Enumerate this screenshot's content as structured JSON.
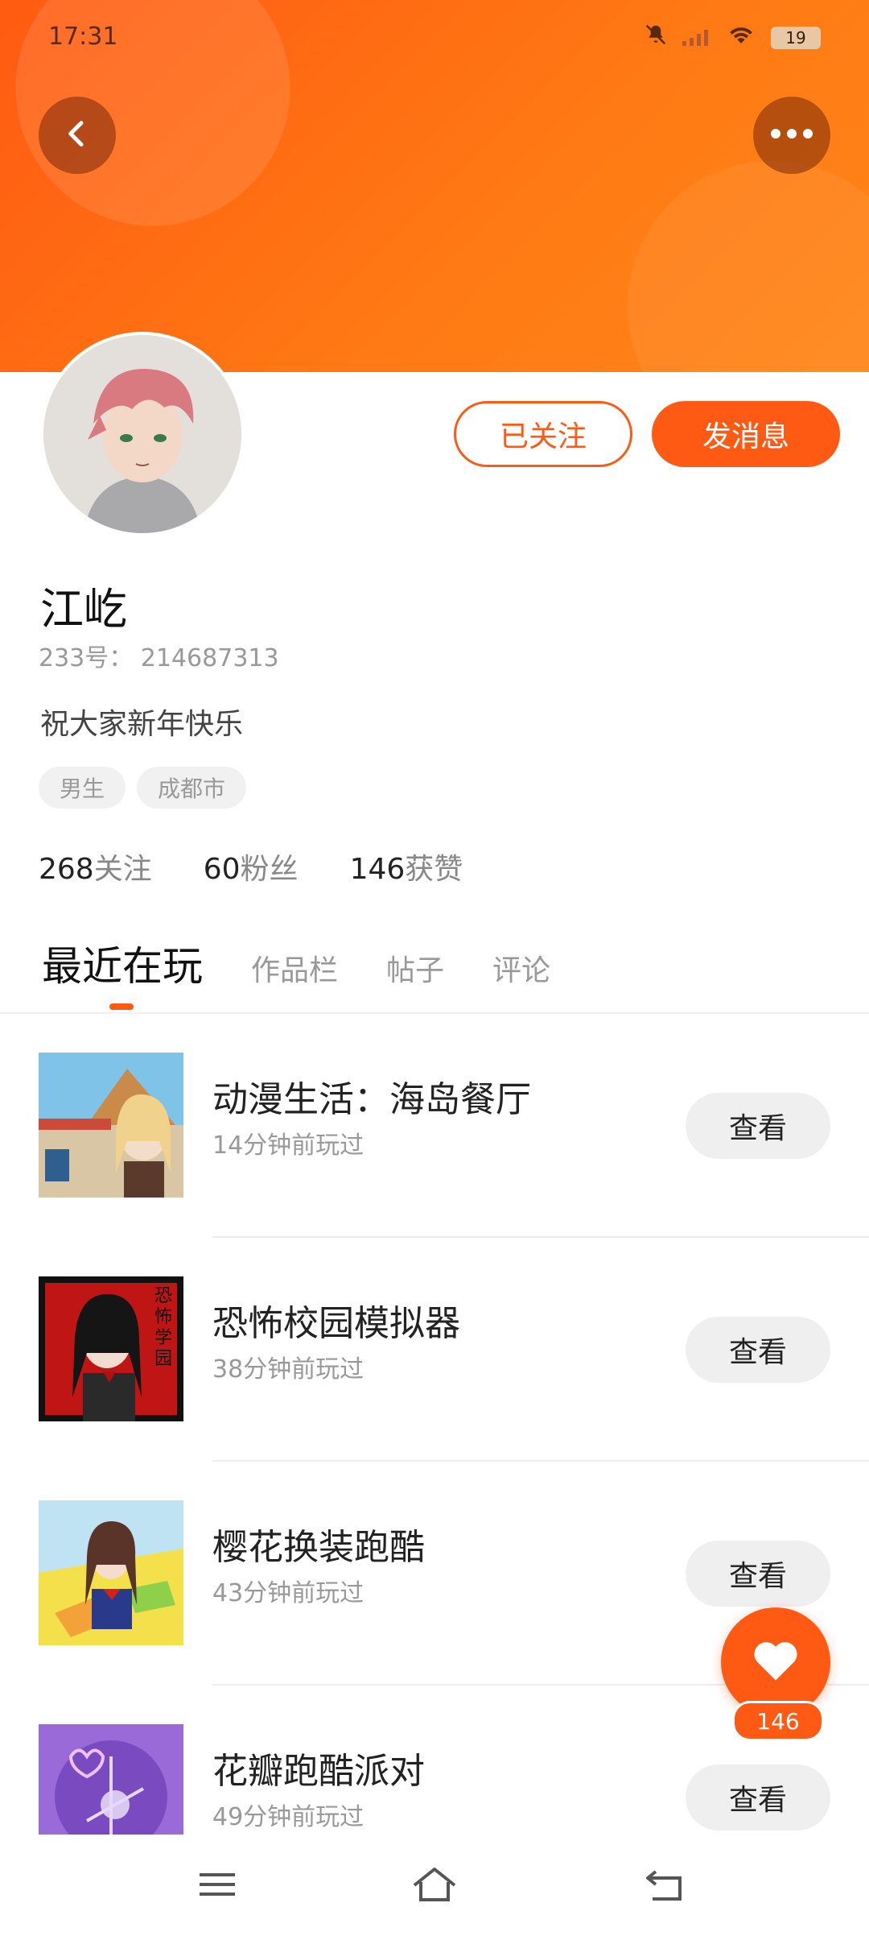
{
  "status_bar": {
    "time": "17:31",
    "battery": "19"
  },
  "header": {
    "back_icon": "back-arrow-icon",
    "more_icon": "more-dots-icon",
    "accent": "#ff5a14"
  },
  "profile": {
    "name": "江屹",
    "id_text": "233号： 214687313",
    "bio": "祝大家新年快乐",
    "tags": [
      "男生",
      "成都市"
    ],
    "follow_label": "已关注",
    "message_label": "发消息",
    "stats": [
      {
        "num": "268",
        "label": "关注"
      },
      {
        "num": "60",
        "label": "粉丝"
      },
      {
        "num": "146",
        "label": "获赞"
      }
    ]
  },
  "tabs": [
    "最近在玩",
    "作品栏",
    "帖子",
    "评论"
  ],
  "games": [
    {
      "title": "动漫生活：海岛餐厅",
      "time": "14分钟前玩过",
      "button": "查看"
    },
    {
      "title": "恐怖校园模拟器",
      "time": "38分钟前玩过",
      "button": "查看",
      "thumb_text": "恐怖学园"
    },
    {
      "title": "樱花换装跑酷",
      "time": "43分钟前玩过",
      "button": "查看"
    },
    {
      "title": "花瓣跑酷派对",
      "time": "49分钟前玩过",
      "button": "查看"
    }
  ],
  "like": {
    "icon": "heart-icon",
    "count": "146"
  },
  "nav": {
    "menu_icon": "menu-icon",
    "home_icon": "home-icon",
    "back_icon": "return-icon"
  }
}
